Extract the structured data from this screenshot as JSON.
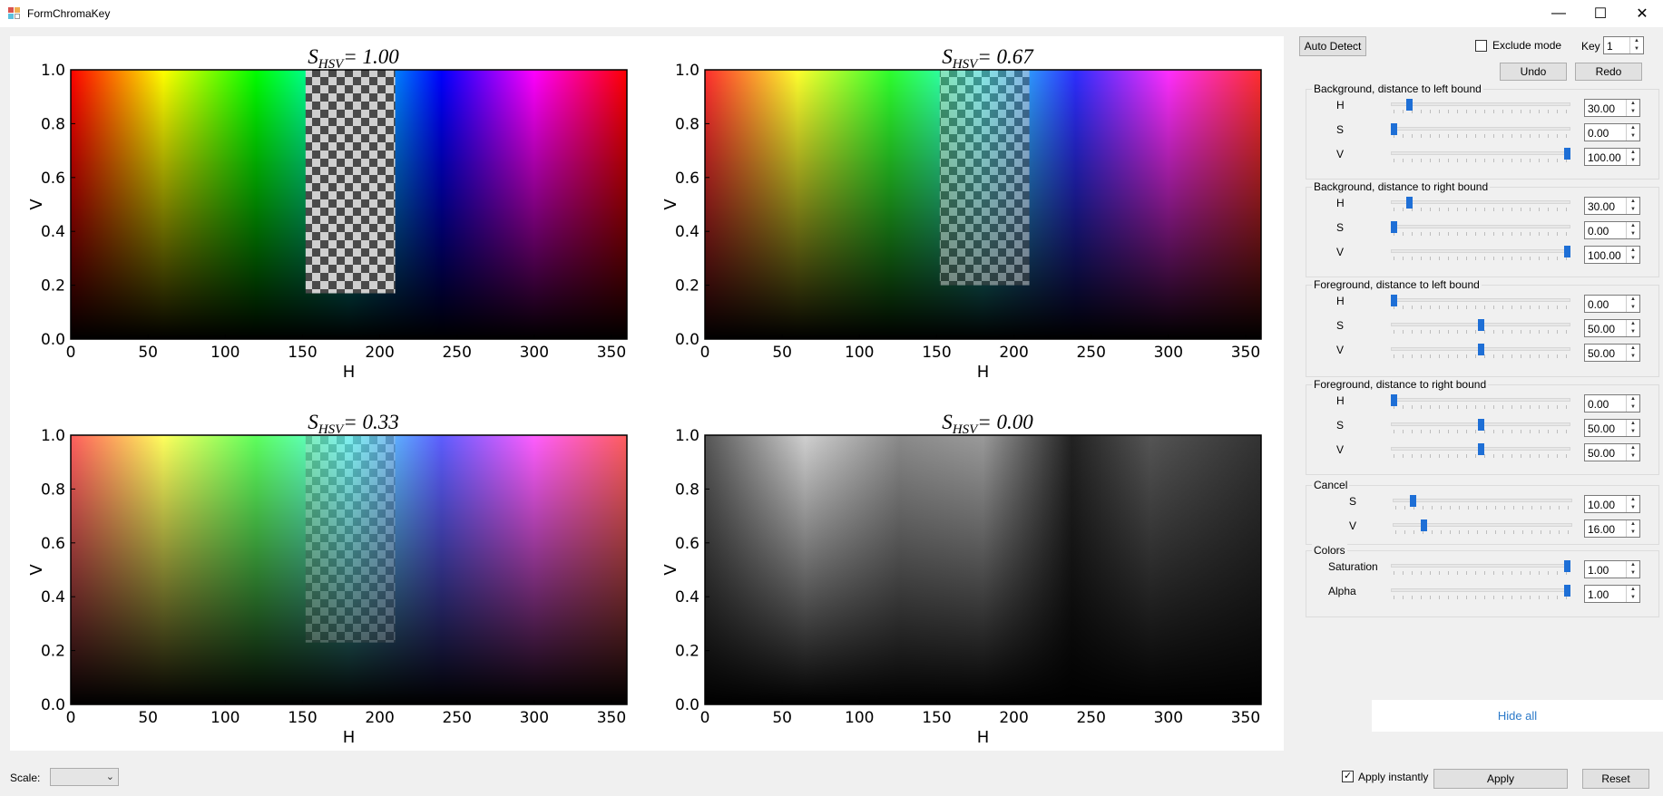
{
  "window": {
    "title": "FormChromaKey",
    "controls": [
      "—",
      "☐",
      "✕"
    ]
  },
  "plots": [
    {
      "title_main": "S",
      "title_sub": "HSV",
      "title_value": "= 1.00",
      "xlabel": "H",
      "ylabel": "V",
      "saturation": 1.0,
      "cutout": "strong"
    },
    {
      "title_main": "S",
      "title_sub": "HSV",
      "title_value": "= 0.67",
      "xlabel": "H",
      "ylabel": "V",
      "saturation": 0.67,
      "cutout": "medium"
    },
    {
      "title_main": "S",
      "title_sub": "HSV",
      "title_value": "= 0.33",
      "xlabel": "H",
      "ylabel": "V",
      "saturation": 0.33,
      "cutout": "light"
    },
    {
      "title_main": "S",
      "title_sub": "HSV",
      "title_value": "= 0.00",
      "xlabel": "H",
      "ylabel": "V",
      "saturation": 0.0,
      "cutout": "none"
    }
  ],
  "axes": {
    "x_ticks": [
      "0",
      "50",
      "100",
      "150",
      "200",
      "250",
      "300",
      "350"
    ],
    "y_ticks": [
      "0.0",
      "0.2",
      "0.4",
      "0.6",
      "0.8",
      "1.0"
    ],
    "x_range": [
      0,
      360
    ],
    "y_range": [
      0,
      1
    ]
  },
  "toolbar": {
    "auto_detect": "Auto Detect",
    "exclude_mode": "Exclude mode",
    "exclude_checked": false,
    "key_label": "Key",
    "key_value": "1",
    "undo": "Undo",
    "redo": "Redo"
  },
  "groups": [
    {
      "title": "Background, distance to left bound",
      "rows": [
        {
          "label": "H",
          "value": "30.00",
          "level": 0.09
        },
        {
          "label": "S",
          "value": "0.00",
          "level": 0.0
        },
        {
          "label": "V",
          "value": "100.00",
          "level": 1.0
        }
      ]
    },
    {
      "title": "Background, distance to right bound",
      "rows": [
        {
          "label": "H",
          "value": "30.00",
          "level": 0.09
        },
        {
          "label": "S",
          "value": "0.00",
          "level": 0.0
        },
        {
          "label": "V",
          "value": "100.00",
          "level": 1.0
        }
      ]
    },
    {
      "title": "Foreground, distance to left bound",
      "rows": [
        {
          "label": "H",
          "value": "0.00",
          "level": 0.0
        },
        {
          "label": "S",
          "value": "50.00",
          "level": 0.5
        },
        {
          "label": "V",
          "value": "50.00",
          "level": 0.5
        }
      ]
    },
    {
      "title": "Foreground, distance to right bound",
      "rows": [
        {
          "label": "H",
          "value": "0.00",
          "level": 0.0
        },
        {
          "label": "S",
          "value": "50.00",
          "level": 0.5
        },
        {
          "label": "V",
          "value": "50.00",
          "level": 0.5
        }
      ]
    },
    {
      "title": "Cancel",
      "rows": [
        {
          "label": "S",
          "value": "10.00",
          "level": 0.1
        },
        {
          "label": "V",
          "value": "16.00",
          "level": 0.16
        }
      ]
    },
    {
      "title": "Colors",
      "rows": [
        {
          "label": "Saturation",
          "value": "1.00",
          "level": 1.0
        },
        {
          "label": "Alpha",
          "value": "1.00",
          "level": 1.0
        }
      ]
    }
  ],
  "hide_all": "Hide all",
  "bottom": {
    "scale_label": "Scale:",
    "scale_value": "",
    "apply_instantly": "Apply instantly",
    "apply_instantly_checked": true,
    "apply": "Apply",
    "reset": "Reset"
  },
  "colors": {
    "accent": "#1e6fd6",
    "link": "#2c7ac9"
  }
}
